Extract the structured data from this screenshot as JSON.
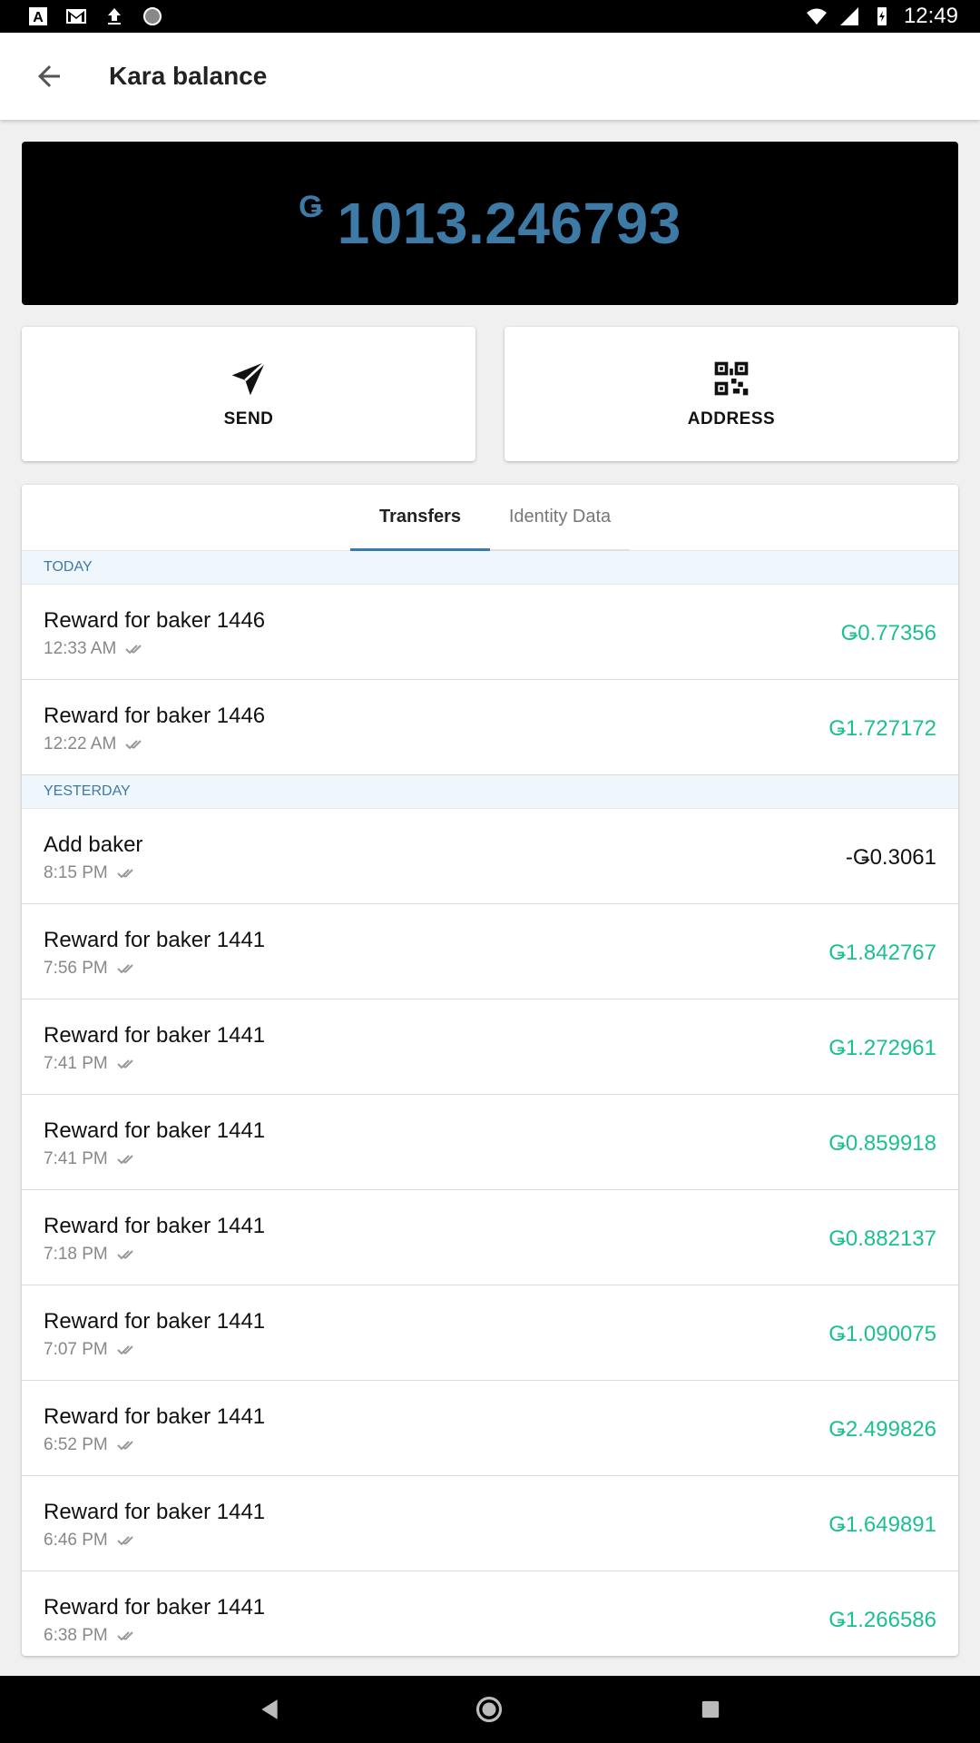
{
  "status_bar": {
    "time": "12:49",
    "left_icons": [
      "text-a-icon",
      "gmail-icon",
      "upload-icon",
      "circle-icon"
    ],
    "right_icons": [
      "wifi-icon",
      "signal-icon",
      "battery-icon"
    ]
  },
  "app_bar": {
    "title": "Kara balance",
    "back_icon": "arrow-left-icon"
  },
  "balance": {
    "currency_symbol": "Ǥ",
    "amount": "1013.246793",
    "color": "#3d7aa6"
  },
  "actions": {
    "send_label": "SEND",
    "address_label": "ADDRESS"
  },
  "tabs": [
    {
      "label": "Transfers",
      "active": true
    },
    {
      "label": "Identity Data",
      "active": false
    }
  ],
  "sections": [
    {
      "header": "TODAY",
      "rows": [
        {
          "title": "Reward for baker 1446",
          "time": "12:33 AM",
          "amount": "Ǥ0.77356",
          "positive": true
        },
        {
          "title": "Reward for baker 1446",
          "time": "12:22 AM",
          "amount": "Ǥ1.727172",
          "positive": true
        }
      ]
    },
    {
      "header": "YESTERDAY",
      "rows": [
        {
          "title": "Add baker",
          "time": "8:15 PM",
          "amount": "-Ǥ0.3061",
          "positive": false
        },
        {
          "title": "Reward for baker 1441",
          "time": "7:56 PM",
          "amount": "Ǥ1.842767",
          "positive": true
        },
        {
          "title": "Reward for baker 1441",
          "time": "7:41 PM",
          "amount": "Ǥ1.272961",
          "positive": true
        },
        {
          "title": "Reward for baker 1441",
          "time": "7:41 PM",
          "amount": "Ǥ0.859918",
          "positive": true
        },
        {
          "title": "Reward for baker 1441",
          "time": "7:18 PM",
          "amount": "Ǥ0.882137",
          "positive": true
        },
        {
          "title": "Reward for baker 1441",
          "time": "7:07 PM",
          "amount": "Ǥ1.090075",
          "positive": true
        },
        {
          "title": "Reward for baker 1441",
          "time": "6:52 PM",
          "amount": "Ǥ2.499826",
          "positive": true
        },
        {
          "title": "Reward for baker 1441",
          "time": "6:46 PM",
          "amount": "Ǥ1.649891",
          "positive": true
        },
        {
          "title": "Reward for baker 1441",
          "time": "6:38 PM",
          "amount": "Ǥ1.266586",
          "positive": true
        }
      ]
    }
  ],
  "colors": {
    "accent": "#3d7aa6",
    "positive_amount": "#1cbf91",
    "section_bg": "#f0f7fc"
  }
}
